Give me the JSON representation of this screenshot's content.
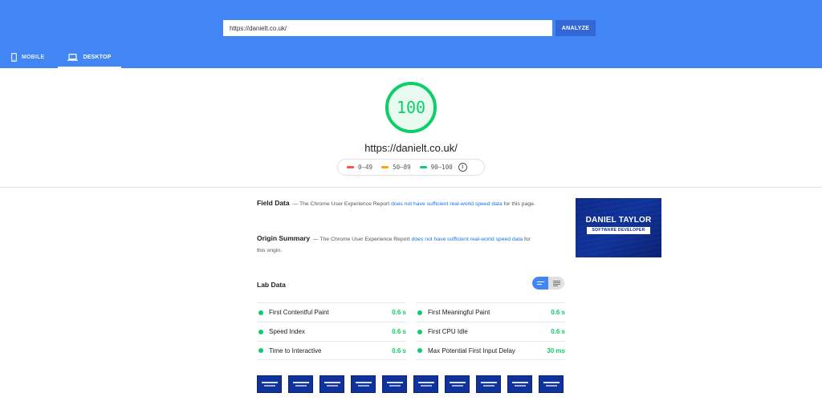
{
  "header": {
    "url_value": "https://danielt.co.uk/",
    "analyze_label": "ANALYZE",
    "tabs": [
      {
        "label": "MOBILE",
        "active": false
      },
      {
        "label": "DESKTOP",
        "active": true
      }
    ],
    "color": "#4285f4"
  },
  "score": {
    "value": "100",
    "url": "https://danielt.co.uk/",
    "color": "#0cce6b",
    "legend": [
      {
        "label": "0–49",
        "color": "#ff4e42"
      },
      {
        "label": "50–89",
        "color": "#ffa400"
      },
      {
        "label": "90–100",
        "color": "#0cce6b"
      }
    ],
    "info_icon": "info-icon"
  },
  "field_data": {
    "title": "Field Data",
    "prefix": "— The Chrome User Experience Report",
    "link": "does not have sufficient real-world speed data",
    "suffix": "for this page."
  },
  "origin_summary": {
    "title": "Origin Summary",
    "prefix": "— The Chrome User Experience Report",
    "link": "does not have sufficient real-world speed data",
    "suffix": "for this origin."
  },
  "thumbnail": {
    "name": "DANIEL TAYLOR",
    "role": "SOFTWARE DEVELOPER"
  },
  "lab_data": {
    "title": "Lab Data",
    "left": [
      {
        "label": "First Contentful Paint",
        "value": "0.6 s"
      },
      {
        "label": "Speed Index",
        "value": "0.6 s"
      },
      {
        "label": "Time to Interactive",
        "value": "0.6 s"
      }
    ],
    "right": [
      {
        "label": "First Meaningful Paint",
        "value": "0.6 s"
      },
      {
        "label": "First CPU Idle",
        "value": "0.6 s"
      },
      {
        "label": "Max Potential First Input Delay",
        "value": "30 ms"
      }
    ]
  },
  "filmstrip": {
    "frame_count": 10
  }
}
